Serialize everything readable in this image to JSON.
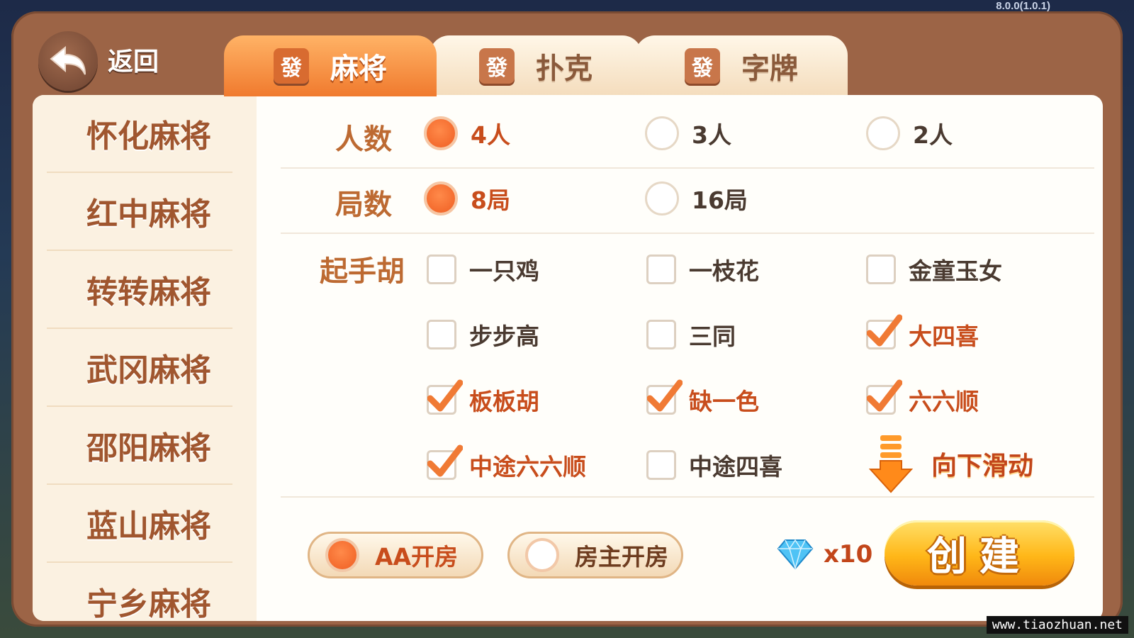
{
  "version": "8.0.0(1.0.1)",
  "watermark": "www.tiaozhuan.net",
  "header": {
    "back_label": "返回",
    "tabs": [
      {
        "badge": "發",
        "label": "麻将",
        "active": true
      },
      {
        "badge": "發",
        "label": "扑克",
        "active": false
      },
      {
        "badge": "發",
        "label": "字牌",
        "active": false
      }
    ]
  },
  "sidebar": {
    "items": [
      "怀化麻将",
      "红中麻将",
      "转转麻将",
      "武冈麻将",
      "邵阳麻将",
      "蓝山麻将",
      "宁乡麻将"
    ]
  },
  "settings": {
    "players": {
      "label": "人数",
      "options": [
        {
          "text": "4人",
          "selected": true
        },
        {
          "text": "3人",
          "selected": false
        },
        {
          "text": "2人",
          "selected": false
        }
      ]
    },
    "rounds": {
      "label": "局数",
      "options": [
        {
          "text": "8局",
          "selected": true
        },
        {
          "text": "16局",
          "selected": false
        }
      ]
    },
    "starting_hu": {
      "label": "起手胡",
      "options": [
        {
          "text": "一只鸡",
          "checked": false
        },
        {
          "text": "一枝花",
          "checked": false
        },
        {
          "text": "金童玉女",
          "checked": false
        },
        {
          "text": "步步高",
          "checked": false
        },
        {
          "text": "三同",
          "checked": false
        },
        {
          "text": "大四喜",
          "checked": true
        },
        {
          "text": "板板胡",
          "checked": true
        },
        {
          "text": "缺一色",
          "checked": true
        },
        {
          "text": "六六顺",
          "checked": true
        },
        {
          "text": "中途六六顺",
          "checked": true
        },
        {
          "text": "中途四喜",
          "checked": false
        }
      ]
    },
    "scroll_hint": "向下滑动"
  },
  "footer": {
    "pay_options": [
      {
        "text": "AA开房",
        "selected": true
      },
      {
        "text": "房主开房",
        "selected": false
      }
    ],
    "cost": "x10",
    "create_label": "创建"
  },
  "colors": {
    "accent": "#ef5e22",
    "frame": "#9c6446",
    "gold": "#ffb718"
  }
}
